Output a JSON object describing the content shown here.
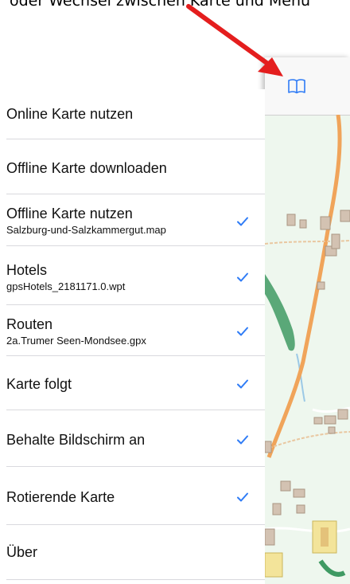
{
  "caption": "oder Wechsel zwischen Karte und Menü",
  "colors": {
    "accent": "#2f7cf6",
    "arrow": "#e41e1e",
    "road": "#f0a45a",
    "forest": "#3f9a63",
    "map_bg": "#eef7ee"
  },
  "menu": {
    "items": [
      {
        "title": "Online Karte nutzen",
        "subtitle": "",
        "checked": false
      },
      {
        "title": "Offline Karte downloaden",
        "subtitle": "",
        "checked": false
      },
      {
        "title": "Offline Karte nutzen",
        "subtitle": "Salzburg-und-Salzkammergut.map",
        "checked": true
      },
      {
        "title": "Hotels",
        "subtitle": "gpsHotels_2181171.0.wpt",
        "checked": true
      },
      {
        "title": "Routen",
        "subtitle": "2a.Trumer Seen-Mondsee.gpx",
        "checked": true
      },
      {
        "title": "Karte folgt",
        "subtitle": "",
        "checked": true
      },
      {
        "title": "Behalte Bildschirm an",
        "subtitle": "",
        "checked": true
      },
      {
        "title": "Rotierende Karte",
        "subtitle": "",
        "checked": true
      },
      {
        "title": "Über",
        "subtitle": "",
        "checked": false
      }
    ]
  },
  "toolbar": {
    "menu_icon": "book-icon"
  },
  "icons": {
    "check": "checkmark-icon",
    "arrow": "arrow-icon"
  }
}
